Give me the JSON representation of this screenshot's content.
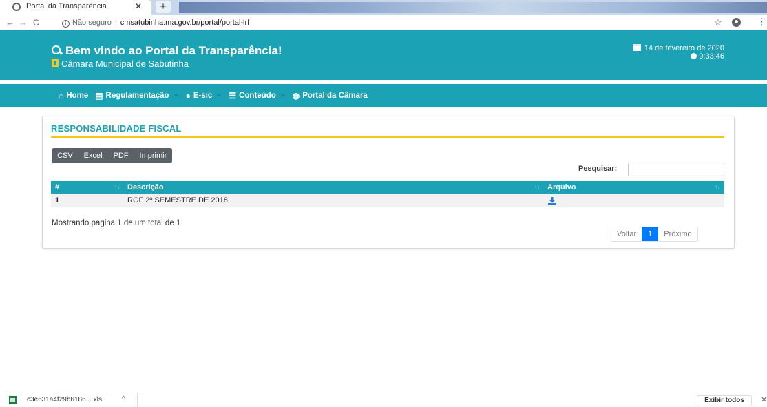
{
  "browser": {
    "tab_title": "Portal da Transparência",
    "tab_close": "✕",
    "new_tab": "+",
    "security_label": "Não seguro",
    "url": "cmsatubinha.ma.gov.br/portal/portal-lrf"
  },
  "header": {
    "welcome": "Bem vindo ao Portal da Transparência!",
    "chamber": "Câmara Municipal de Sabutinha",
    "date": "14 de fevereiro de 2020",
    "time": "9:33:46",
    "background_color": "#1ba3b5",
    "accent_color": "#f5c518"
  },
  "nav": {
    "items": [
      {
        "label": "Home",
        "icon": "home-icon",
        "has_caret": false
      },
      {
        "label": "Regulamentação",
        "icon": "book-icon",
        "has_caret": true
      },
      {
        "label": "E-sic",
        "icon": "info-circle-icon",
        "has_caret": true
      },
      {
        "label": "Conteúdo",
        "icon": "list-icon",
        "has_caret": true
      },
      {
        "label": "Portal da Câmara",
        "icon": "globe-icon",
        "has_caret": false
      }
    ]
  },
  "panel": {
    "title": "RESPONSABILIDADE FISCAL",
    "export_buttons": [
      "CSV",
      "Excel",
      "PDF",
      "Imprimir"
    ],
    "search_label": "Pesquisar:",
    "search_value": "",
    "columns": [
      "#",
      "Descrição",
      "Arquivo"
    ],
    "rows": [
      {
        "num": "1",
        "descricao": "RGF 2º SEMESTRE DE 2018",
        "arquivo": "download-icon"
      }
    ],
    "info": "Mostrando pagina 1 de um total de 1",
    "pagination": {
      "prev": "Voltar",
      "current": "1",
      "next": "Próximo"
    }
  },
  "download_bar": {
    "file_name": "c3e631a4f29b6186....xls",
    "show_all": "Exibir todos"
  }
}
